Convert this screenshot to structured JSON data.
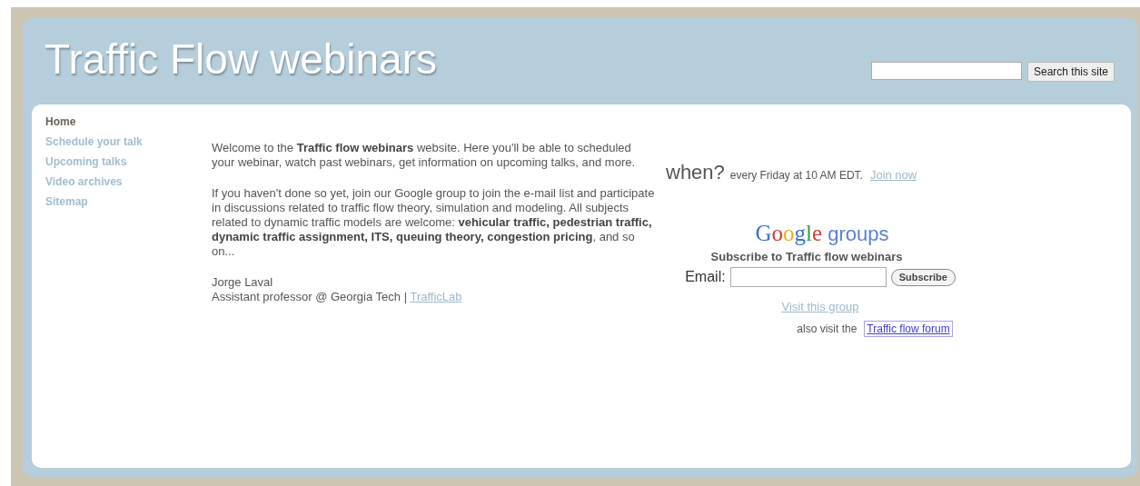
{
  "site_title": "Traffic Flow webinars",
  "search": {
    "button": "Search this site"
  },
  "nav": [
    {
      "label": "Home",
      "selected": true
    },
    {
      "label": "Schedule your talk",
      "selected": false
    },
    {
      "label": "Upcoming talks",
      "selected": false
    },
    {
      "label": "Video archives",
      "selected": false
    },
    {
      "label": "Sitemap",
      "selected": false
    }
  ],
  "intro": [
    "Welcome to the **Traffic flow webinars** website. Here you'll be able to  scheduled your webinar, watch past webinars, get information on upcoming talks, and more.",
    "If you haven't done so yet, join our Google group to join the e-mail list and participate in discussions related to traffic flow theory, simulation and modeling. All subjects related to dynamic traffic models are welcome: **vehicular traffic, pedestrian traffic, dynamic traffic assignment, ITS, queuing theory, congestion pricing**, and so on..."
  ],
  "signature": {
    "name": "Jorge Laval",
    "role": "Assistant professor @ Georgia Tech |",
    "link": "TrafficLab"
  },
  "when": {
    "label": "when?",
    "schedule": "every Friday at 10 AM EDT.",
    "link": "Join now"
  },
  "google_groups": {
    "logo_word": "Google",
    "logo_suffix": "groups",
    "subscribe_title": "Subscribe to Traffic flow webinars",
    "email_label": "Email:",
    "button": "Subscribe",
    "visit_link": "Visit this group",
    "also_text": "also visit the",
    "forum_link": "Traffic flow forum"
  }
}
